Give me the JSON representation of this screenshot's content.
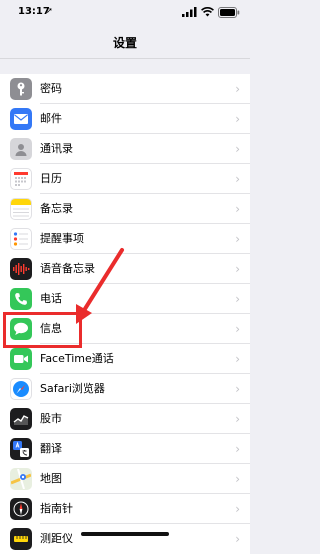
{
  "status_bar": {
    "time": "13:17",
    "location_arrow": "➚"
  },
  "nav": {
    "title": "设置"
  },
  "settings_items": [
    {
      "label": "密码",
      "icon": "key-icon",
      "color": "#8e8e93"
    },
    {
      "label": "邮件",
      "icon": "mail-icon",
      "color": "#3478f6"
    },
    {
      "label": "通讯录",
      "icon": "contacts-icon",
      "color": "#a5a5aa"
    },
    {
      "label": "日历",
      "icon": "calendar-icon",
      "color": "#ffffff"
    },
    {
      "label": "备忘录",
      "icon": "notes-icon",
      "color": "#ffd60a"
    },
    {
      "label": "提醒事项",
      "icon": "reminders-icon",
      "color": "#ffffff"
    },
    {
      "label": "语音备忘录",
      "icon": "voice-memos-icon",
      "color": "#1c1c1e"
    },
    {
      "label": "电话",
      "icon": "phone-icon",
      "color": "#34c759"
    },
    {
      "label": "信息",
      "icon": "messages-icon",
      "color": "#34c759"
    },
    {
      "label": "FaceTime通话",
      "icon": "facetime-icon",
      "color": "#34c759"
    },
    {
      "label": "Safari浏览器",
      "icon": "safari-icon",
      "color": "#ffffff"
    },
    {
      "label": "股市",
      "icon": "stocks-icon",
      "color": "#1c1c1e"
    },
    {
      "label": "翻译",
      "icon": "translate-icon",
      "color": "#1c1c1e"
    },
    {
      "label": "地图",
      "icon": "maps-icon",
      "color": "#e8efe0"
    },
    {
      "label": "指南针",
      "icon": "compass-icon",
      "color": "#1c1c1e"
    },
    {
      "label": "测距仪",
      "icon": "measure-icon",
      "color": "#1c1c1e"
    }
  ],
  "chevron": "›",
  "annotation": {
    "color": "#ea2c2c"
  }
}
